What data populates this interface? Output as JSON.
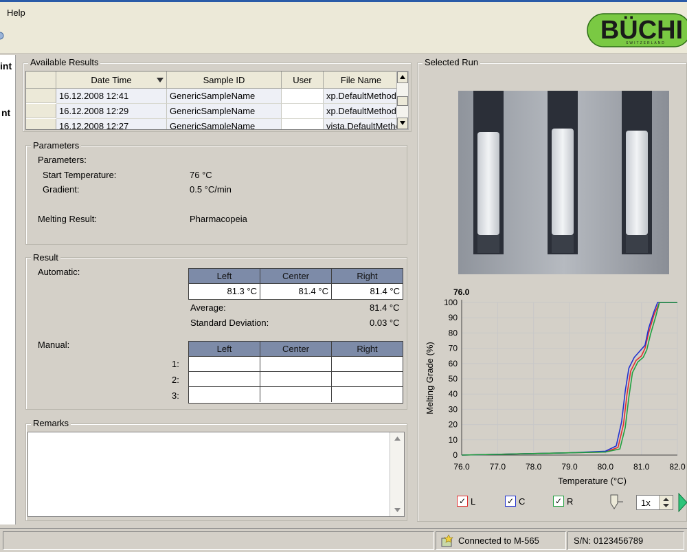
{
  "menu": {
    "help": "Help"
  },
  "brand": {
    "logo": "BÜCHI",
    "tagline": "SWITZERLAND",
    "color": "#7ac943"
  },
  "nav": {
    "items": [
      "int",
      "nt"
    ]
  },
  "available_results": {
    "title": "Available Results",
    "columns": [
      "Date Time",
      "Sample ID",
      "User",
      "File Name"
    ],
    "rows": [
      {
        "datetime": "16.12.2008 12:41",
        "sample": "GenericSampleName",
        "user": "",
        "file": "xp.DefaultMethodN"
      },
      {
        "datetime": "16.12.2008 12:29",
        "sample": "GenericSampleName",
        "user": "",
        "file": "xp.DefaultMethodN"
      },
      {
        "datetime": "16.12.2008 12:27",
        "sample": "GenericSampleName",
        "user": "",
        "file": "vista.DefaultMethod"
      }
    ]
  },
  "parameters": {
    "title": "Parameters",
    "heading": "Parameters:",
    "start_temp_label": "Start Temperature:",
    "start_temp_value": "76 °C",
    "gradient_label": "Gradient:",
    "gradient_value": "0.5 °C/min",
    "melting_label": "Melting Result:",
    "melting_value": "Pharmacopeia"
  },
  "result": {
    "title": "Result",
    "automatic_label": "Automatic:",
    "columns": [
      "Left",
      "Center",
      "Right"
    ],
    "automatic_values": [
      "81.3 °C",
      "81.4 °C",
      "81.4 °C"
    ],
    "average_label": "Average:",
    "average_value": "81.4 °C",
    "stddev_label": "Standard Deviation:",
    "stddev_value": "0.03 °C",
    "manual_label": "Manual:",
    "manual_rows": [
      "1:",
      "2:",
      "3:"
    ]
  },
  "remarks": {
    "title": "Remarks",
    "value": ""
  },
  "selected_run": {
    "title": "Selected Run"
  },
  "chart_data": {
    "type": "line",
    "title": "76.0",
    "xlabel": "Temperature (°C)",
    "ylabel": "Melting Grade (%)",
    "xlim": [
      76.0,
      82.0
    ],
    "ylim": [
      0,
      100
    ],
    "xticks": [
      "76.0",
      "77.0",
      "78.0",
      "79.0",
      "80.0",
      "81.0",
      "82.0"
    ],
    "yticks": [
      "0",
      "10",
      "20",
      "30",
      "40",
      "50",
      "60",
      "70",
      "80",
      "90",
      "100"
    ],
    "grid": true,
    "series": [
      {
        "name": "L",
        "color": "#e03030",
        "x": [
          76.0,
          77.0,
          78.0,
          79.0,
          80.0,
          80.35,
          80.5,
          80.6,
          80.7,
          80.85,
          81.0,
          81.1,
          81.2,
          81.35,
          81.5,
          81.6,
          82.0
        ],
        "y": [
          0,
          0.5,
          1,
          1.5,
          2,
          5,
          20,
          40,
          55,
          62,
          65,
          70,
          80,
          92,
          100,
          100,
          100
        ]
      },
      {
        "name": "C",
        "color": "#2030d0",
        "x": [
          76.0,
          77.0,
          78.0,
          79.0,
          80.0,
          80.3,
          80.45,
          80.55,
          80.65,
          80.8,
          80.95,
          81.1,
          81.2,
          81.35,
          81.45,
          81.6,
          82.0
        ],
        "y": [
          0,
          0.5,
          1,
          1.5,
          2.5,
          6,
          22,
          42,
          57,
          64,
          68,
          72,
          83,
          94,
          100,
          100,
          100
        ]
      },
      {
        "name": "R",
        "color": "#20a040",
        "x": [
          76.0,
          77.0,
          78.0,
          79.0,
          80.0,
          80.4,
          80.55,
          80.65,
          80.75,
          80.9,
          81.05,
          81.15,
          81.25,
          81.4,
          81.5,
          81.6,
          82.0
        ],
        "y": [
          0,
          0.5,
          1,
          1.5,
          2,
          4,
          18,
          38,
          54,
          61,
          64,
          69,
          79,
          91,
          100,
          100,
          100
        ]
      }
    ]
  },
  "controls": {
    "check_l": "L",
    "check_c": "C",
    "check_r": "R",
    "speed_value": "1x"
  },
  "status": {
    "connection": "Connected to M-565",
    "serial": "S/N: 0123456789"
  }
}
